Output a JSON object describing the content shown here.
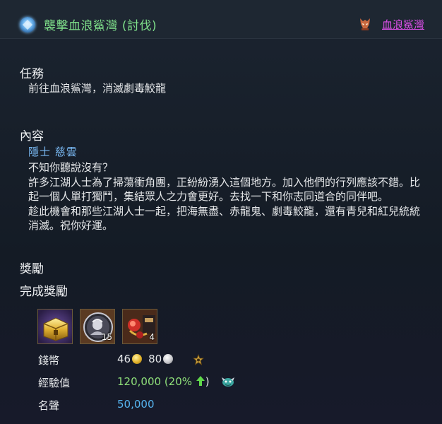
{
  "header": {
    "icon": "quest-orb-icon",
    "title": "襲擊血浪鯊灣 (討伐)",
    "location_icon": "fox-mask-icon",
    "location_link": "血浪鯊灣"
  },
  "task": {
    "heading": "任務",
    "text": "前往血浪鯊灣，消滅劇毒鮫龍"
  },
  "content": {
    "heading": "內容",
    "npc": "隱士 慈雲",
    "lines": [
      "不知你聽說沒有？",
      "許多江湖人士為了掃蕩衝角團，正紛紛湧入這個地方。加入他們的行列應該不錯。比起一個人單打獨鬥，集結眾人之力會更好。去找一下和你志同道合的同伴吧。",
      "趁此機會和那些江湖人士一起，把海無盡、赤龍鬼、劇毒鮫龍，還有青兒和紅兒統統消滅。祝你好運。"
    ]
  },
  "rewards": {
    "heading": "獎勵",
    "subheading": "完成獎勵",
    "items": [
      {
        "icon": "golden-chest-icon",
        "count": ""
      },
      {
        "icon": "portrait-token-icon",
        "count": "15"
      },
      {
        "icon": "red-ornament-icon",
        "count": "4"
      }
    ],
    "money": {
      "label": "錢幣",
      "gold": "46",
      "silver": "80",
      "gold_icon": "gold-coin-icon",
      "silver_icon": "silver-coin-icon",
      "bonus_icon": "star-icon"
    },
    "exp": {
      "label": "經驗值",
      "value": "120,000",
      "bonus_open": "(20%",
      "bonus_close": ")",
      "arrow_icon": "up-arrow-icon",
      "pet_icon": "dragon-icon"
    },
    "fame": {
      "label": "名聲",
      "value": "50,000"
    }
  },
  "colors": {
    "title_green": "#7fe08a",
    "link_purple": "#d94fe6",
    "npc_blue": "#79b8f2",
    "exp_green": "#8fe07a",
    "fame_blue": "#56b4f0"
  }
}
